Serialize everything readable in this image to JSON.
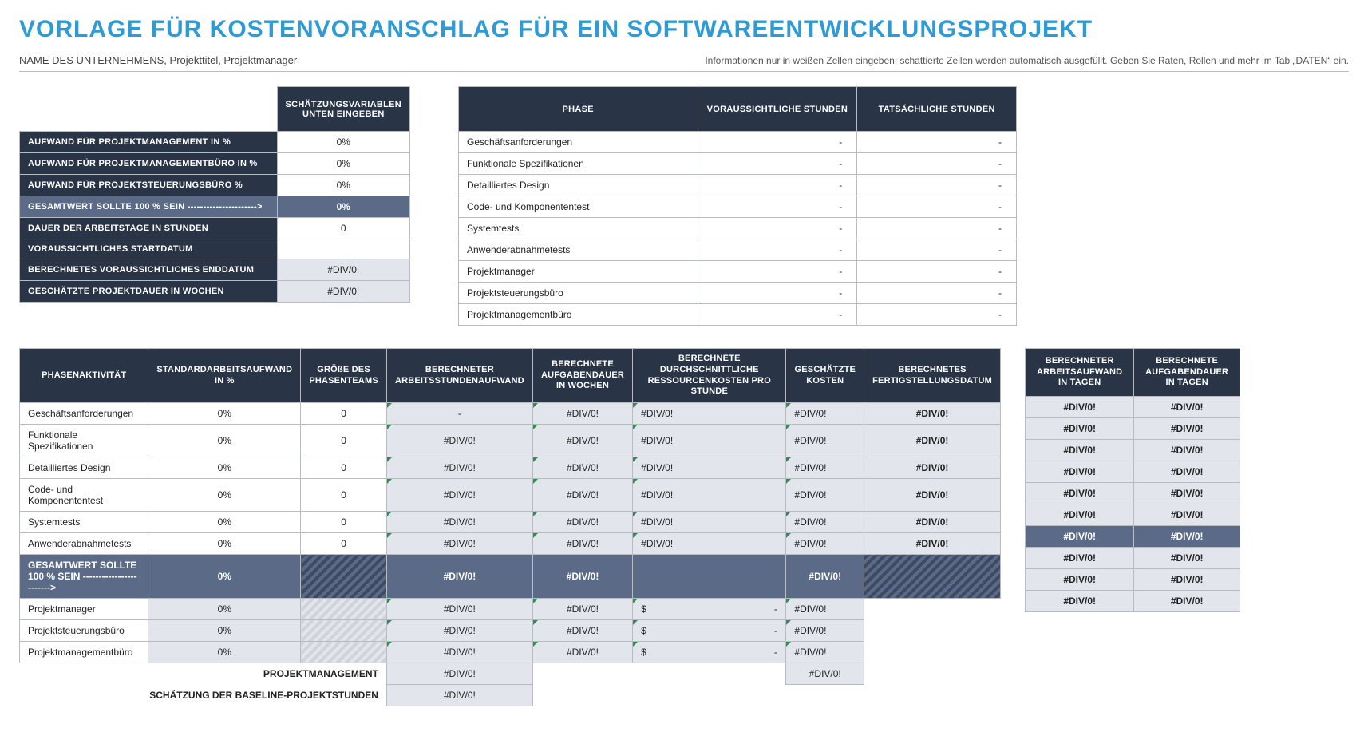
{
  "title": "VORLAGE FÜR KOSTENVORANSCHLAG FÜR EIN SOFTWAREENTWICKLUNGSPROJEKT",
  "subtitle_left": "NAME DES UNTERNEHMENS, Projekttitel, Projektmanager",
  "subtitle_right": "Informationen nur in weißen Zellen eingeben; schattierte Zellen werden automatisch ausgefüllt.  Geben Sie Raten, Rollen und mehr im Tab „DATEN“ ein.",
  "est": {
    "header": "SCHÄTZUNGSVARIABLEN UNTEN EINGEBEN",
    "rows": [
      {
        "label": "AUFWAND FÜR PROJEKTMANAGEMENT IN %",
        "value": "0%",
        "style": "dark"
      },
      {
        "label": "AUFWAND FÜR PROJEKTMANAGEMENTBÜRO IN %",
        "value": "0%",
        "style": "dark"
      },
      {
        "label": "AUFWAND FÜR PROJEKTSTEUERUNGSBÜRO %",
        "value": "0%",
        "style": "dark"
      },
      {
        "label": "GESAMTWERT SOLLTE 100 % SEIN ---------------------->",
        "value": "0%",
        "style": "mid"
      },
      {
        "label": "DAUER DER ARBEITSTAGE IN STUNDEN",
        "value": "0",
        "style": "dark"
      },
      {
        "label": "VORAUSSICHTLICHES STARTDATUM",
        "value": "",
        "style": "dark"
      },
      {
        "label": "BERECHNETES VORAUSSICHTLICHES ENDDATUM",
        "value": "#DIV/0!",
        "style": "calc"
      },
      {
        "label": "GESCHÄTZTE PROJEKTDAUER IN WOCHEN",
        "value": "#DIV/0!",
        "style": "calc"
      }
    ]
  },
  "phase_hours": {
    "headers": [
      "PHASE",
      "VORAUSSICHTLICHE STUNDEN",
      "TATSÄCHLICHE STUNDEN"
    ],
    "rows": [
      {
        "name": "Geschäftsanforderungen",
        "proj": "-",
        "act": "-"
      },
      {
        "name": "Funktionale Spezifikationen",
        "proj": "-",
        "act": "-"
      },
      {
        "name": "Detailliertes Design",
        "proj": "-",
        "act": "-"
      },
      {
        "name": "Code- und Komponententest",
        "proj": "-",
        "act": "-"
      },
      {
        "name": "Systemtests",
        "proj": "-",
        "act": "-"
      },
      {
        "name": "Anwenderabnahmetests",
        "proj": "-",
        "act": "-"
      },
      {
        "name": "Projektmanager",
        "proj": "-",
        "act": "-"
      },
      {
        "name": "Projektsteuerungsbüro",
        "proj": "-",
        "act": "-"
      },
      {
        "name": "Projektmanagementbüro",
        "proj": "-",
        "act": "-"
      }
    ]
  },
  "big": {
    "headers": [
      "PHASENAKTIVITÄT",
      "STANDARDARBEITSAUFWAND IN %",
      "GRÖßE DES PHASENTEAMS",
      "BERECHNETER ARBEITSSTUNDENAUFWAND",
      "BERECHNETE AUFGABENDAUER IN WOCHEN",
      "BERECHNETE DURCHSCHNITTLICHE RESSOURCENKOSTEN PRO STUNDE",
      "GESCHÄTZTE KOSTEN",
      "BERECHNETES FERTIGSTELLUNGSDATUM"
    ],
    "rows_a": [
      {
        "name": "Geschäftsanforderungen",
        "eff": "0%",
        "team": "0",
        "hrs": "-",
        "wks": "#DIV/0!",
        "rate": "#DIV/0!",
        "cost": "#DIV/0!",
        "date": "#DIV/0!"
      },
      {
        "name": "Funktionale Spezifikationen",
        "eff": "0%",
        "team": "0",
        "hrs": "#DIV/0!",
        "wks": "#DIV/0!",
        "rate": "#DIV/0!",
        "cost": "#DIV/0!",
        "date": "#DIV/0!"
      },
      {
        "name": "Detailliertes Design",
        "eff": "0%",
        "team": "0",
        "hrs": "#DIV/0!",
        "wks": "#DIV/0!",
        "rate": "#DIV/0!",
        "cost": "#DIV/0!",
        "date": "#DIV/0!"
      },
      {
        "name": "Code- und Komponententest",
        "eff": "0%",
        "team": "0",
        "hrs": "#DIV/0!",
        "wks": "#DIV/0!",
        "rate": "#DIV/0!",
        "cost": "#DIV/0!",
        "date": "#DIV/0!"
      },
      {
        "name": "Systemtests",
        "eff": "0%",
        "team": "0",
        "hrs": "#DIV/0!",
        "wks": "#DIV/0!",
        "rate": "#DIV/0!",
        "cost": "#DIV/0!",
        "date": "#DIV/0!"
      },
      {
        "name": "Anwenderabnahmetests",
        "eff": "0%",
        "team": "0",
        "hrs": "#DIV/0!",
        "wks": "#DIV/0!",
        "rate": "#DIV/0!",
        "cost": "#DIV/0!",
        "date": "#DIV/0!"
      }
    ],
    "total_row": {
      "name": "GESAMTWERT SOLLTE 100 % SEIN ------------------------>",
      "eff": "0%",
      "hrs": "#DIV/0!",
      "wks": "#DIV/0!",
      "cost": "#DIV/0!"
    },
    "rows_b": [
      {
        "name": "Projektmanager",
        "eff": "0%",
        "hrs": "#DIV/0!",
        "wks": "#DIV/0!",
        "rate": "$                                                -",
        "cost": "#DIV/0!"
      },
      {
        "name": "Projektsteuerungsbüro",
        "eff": "0%",
        "hrs": "#DIV/0!",
        "wks": "#DIV/0!",
        "rate": "$                                                -",
        "cost": "#DIV/0!"
      },
      {
        "name": "Projektmanagementbüro",
        "eff": "0%",
        "hrs": "#DIV/0!",
        "wks": "#DIV/0!",
        "rate": "$                                                -",
        "cost": "#DIV/0!"
      }
    ],
    "sum1": {
      "label": "PROJEKTMANAGEMENT",
      "hrs": "#DIV/0!",
      "cost": "#DIV/0!"
    },
    "sum2": {
      "label": "SCHÄTZUNG DER BASELINE-PROJEKTSTUNDEN",
      "hrs": "#DIV/0!"
    }
  },
  "side": {
    "headers": [
      "BERECHNETER ARBEITSAUFWAND IN TAGEN",
      "BERECHNETE AUFGABENDAUER IN TAGEN"
    ],
    "rows": [
      [
        "#DIV/0!",
        "#DIV/0!"
      ],
      [
        "#DIV/0!",
        "#DIV/0!"
      ],
      [
        "#DIV/0!",
        "#DIV/0!"
      ],
      [
        "#DIV/0!",
        "#DIV/0!"
      ],
      [
        "#DIV/0!",
        "#DIV/0!"
      ],
      [
        "#DIV/0!",
        "#DIV/0!"
      ],
      [
        "#DIV/0!",
        "#DIV/0!"
      ],
      [
        "#DIV/0!",
        "#DIV/0!"
      ],
      [
        "#DIV/0!",
        "#DIV/0!"
      ],
      [
        "#DIV/0!",
        "#DIV/0!"
      ]
    ]
  }
}
